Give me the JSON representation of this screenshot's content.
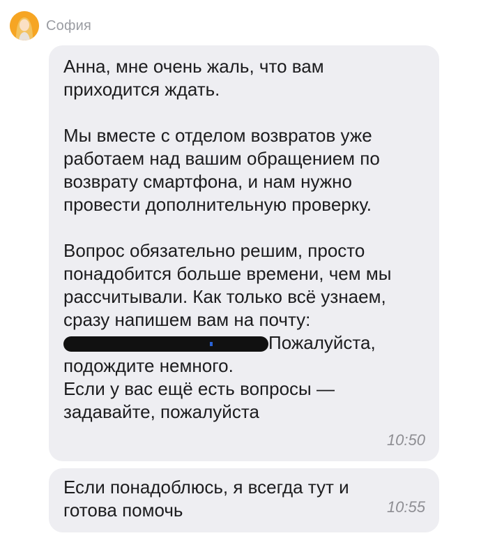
{
  "sender": {
    "name": "София",
    "avatar_icon": "user-avatar-photo"
  },
  "messages": [
    {
      "paragraphs": [
        "Анна, мне очень жаль, что вам\nприходится ждать.",
        "Мы вместе с отделом возвратов уже\nработаем над вашим обращением по\nвозврату смартфона, и нам нужно\nпровести дополнительную проверку.",
        "Вопрос обязательно решим, просто\nпонадобится больше времени, чем мы\nрассчитывали. Как только всё узнаем,\nсразу напишем вам на почту:"
      ],
      "after_redacted": "Пожалуйста,",
      "continued": "подождите немного.",
      "closing": "Если у вас ещё есть вопросы —\nзадавайте, пожалуйста",
      "time": "10:50"
    },
    {
      "text": "Если понадоблюсь, я всегда тут и\nготова помочь",
      "time": "10:55"
    }
  ],
  "colors": {
    "bubble_bg": "#eeeef2",
    "text": "#1c1c1e",
    "meta": "#8e8e93",
    "redaction": "#111111"
  }
}
